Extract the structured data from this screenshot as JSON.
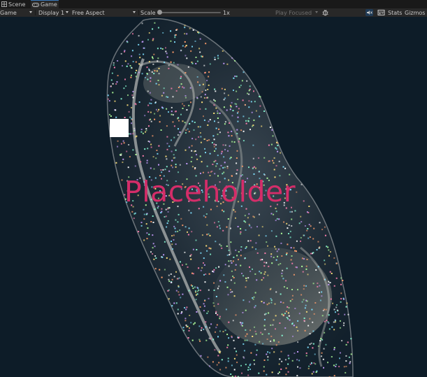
{
  "tabs": {
    "scene": {
      "label": "Scene",
      "icon": "scene-grid-icon"
    },
    "game": {
      "label": "Game",
      "icon": "gamepad-icon"
    }
  },
  "toolbar": {
    "view_select": "Game",
    "display_select": "Display 1",
    "aspect_select": "Free Aspect",
    "scale_label": "Scale",
    "scale_value": "1x",
    "scale_fraction": 0.0,
    "play_mode_select": "Play Focused",
    "bug_icon": "bug-icon",
    "audio_icon": "mute-audio-icon",
    "stats_icon": "stats-display-icon",
    "stats_label": "Stats",
    "gizmos_label": "Gizmos"
  },
  "game_view": {
    "placeholder_text": "Placeholder",
    "placeholder_color": "#d42d69",
    "background_color": "#0d1c28"
  }
}
